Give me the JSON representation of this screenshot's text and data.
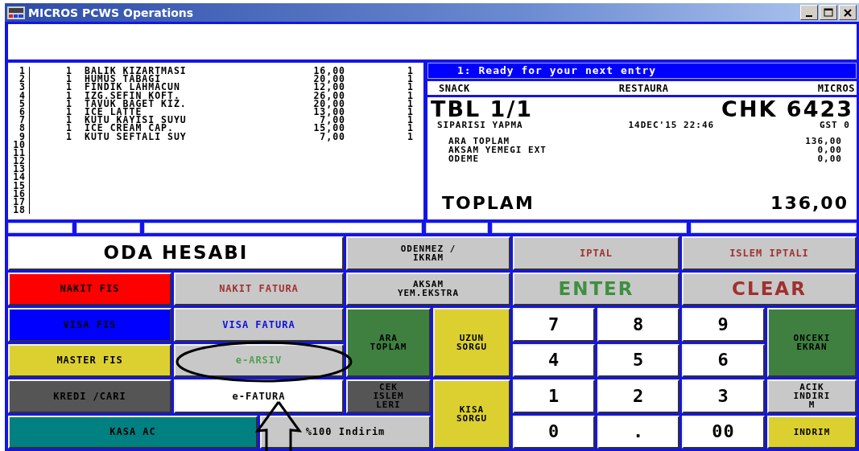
{
  "window": {
    "title": "MICROS PCWS Operations"
  },
  "order_lines": [
    {
      "line": "1",
      "qty": "1",
      "item": "BALIK KIZARTMASI",
      "price": "16,00",
      "seat": "1"
    },
    {
      "line": "2",
      "qty": "1",
      "item": "HUMUS TABAGI",
      "price": "20,00",
      "seat": "1"
    },
    {
      "line": "3",
      "qty": "1",
      "item": "FINDIK LAHMACUN",
      "price": "12,00",
      "seat": "1"
    },
    {
      "line": "4",
      "qty": "1",
      "item": "IZG.SEFIN KOFT.",
      "price": "26,00",
      "seat": "1"
    },
    {
      "line": "5",
      "qty": "1",
      "item": "TAVUK BAGET KIZ.",
      "price": "20,00",
      "seat": "1"
    },
    {
      "line": "6",
      "qty": "1",
      "item": "ICE LATTE",
      "price": "13,00",
      "seat": "1"
    },
    {
      "line": "7",
      "qty": "1",
      "item": "KUTU KAYISI SUYU",
      "price": "7,00",
      "seat": "1"
    },
    {
      "line": "8",
      "qty": "1",
      "item": "ICE CREAM CAP.",
      "price": "15,00",
      "seat": "1"
    },
    {
      "line": "9",
      "qty": "1",
      "item": "KUTU SEFTALI SUY",
      "price": "7,00",
      "seat": "1"
    },
    {
      "line": "10"
    },
    {
      "line": "11"
    },
    {
      "line": "12"
    },
    {
      "line": "13"
    },
    {
      "line": "14"
    },
    {
      "line": "15"
    },
    {
      "line": "16"
    },
    {
      "line": "17"
    },
    {
      "line": "18"
    }
  ],
  "status": "1: Ready for your next entry",
  "header": [
    "SNACK",
    "RESTAURA",
    "MICROS"
  ],
  "check": {
    "table": "TBL 1/1",
    "check_number": "CHK 6423",
    "employee": "SIPARISI YAPMA",
    "datetime": "14DEC'15 22:46",
    "guests": "GST 0",
    "lines": [
      {
        "label": "ARA TOPLAM",
        "amount": "136,00"
      },
      {
        "label": "AKSAM YEMEGI EXT",
        "amount": "0,00"
      },
      {
        "label": "ODEME",
        "amount": "0,00"
      }
    ],
    "total_label": "TOPLAM",
    "total": "136,00"
  },
  "buttons": [
    {
      "label": "ODA HESABI",
      "color": "#ffffff"
    },
    {
      "label": "ODENMEZ / IKRAM",
      "color": "#c8c8c8"
    },
    {
      "label": "IPTAL",
      "color": "#c8c8c8"
    },
    {
      "label": "ISLEM IPTALI",
      "color": "#c8c8c8"
    },
    {
      "label": "NAKIT FIS",
      "color": "#ff0000"
    },
    {
      "label": "NAKIT FATURA",
      "color": "#c8c8c8"
    },
    {
      "label": "AKSAM YEM.EKSTRA",
      "color": "#c8c8c8"
    },
    {
      "label": "ENTER",
      "color": "#c8c8c8"
    },
    {
      "label": "CLEAR",
      "color": "#c8c8c8"
    },
    {
      "label": "VISA FIS",
      "color": "#0000ff"
    },
    {
      "label": "VISA FATURA",
      "color": "#c8c8c8"
    },
    {
      "label": "ARA TOPLAM",
      "color": "#3f8040"
    },
    {
      "label": "UZUN SORGU",
      "color": "#dcd030"
    },
    {
      "label": "7",
      "color": "#ffffff"
    },
    {
      "label": "8",
      "color": "#ffffff"
    },
    {
      "label": "9",
      "color": "#ffffff"
    },
    {
      "label": "ONCEKI EKRAN",
      "color": "#3f8040"
    },
    {
      "label": "MASTER FIS",
      "color": "#dcd030"
    },
    {
      "label": "e-ARSIV",
      "color": "#c8c8c8"
    },
    {
      "label": "4",
      "color": "#ffffff"
    },
    {
      "label": "5",
      "color": "#ffffff"
    },
    {
      "label": "6",
      "color": "#ffffff"
    },
    {
      "label": "KREDI /CARI",
      "color": "#555555"
    },
    {
      "label": "e-FATURA",
      "color": "#ffffff"
    },
    {
      "label": "CEK ISLEM LERI",
      "color": "#555555"
    },
    {
      "label": "KISA SORGU",
      "color": "#dcd030"
    },
    {
      "label": "1",
      "color": "#ffffff"
    },
    {
      "label": "2",
      "color": "#ffffff"
    },
    {
      "label": "3",
      "color": "#ffffff"
    },
    {
      "label": "ACIK INDIRI M",
      "color": "#c8c8c8"
    },
    {
      "label": "KASA AC",
      "color": "#008080"
    },
    {
      "label": "%100 Indirim",
      "color": "#c8c8c8"
    },
    {
      "label": "0",
      "color": "#ffffff"
    },
    {
      "label": ".",
      "color": "#ffffff"
    },
    {
      "label": "00",
      "color": "#ffffff"
    },
    {
      "label": "INDRIM",
      "color": "#dcd030"
    }
  ]
}
